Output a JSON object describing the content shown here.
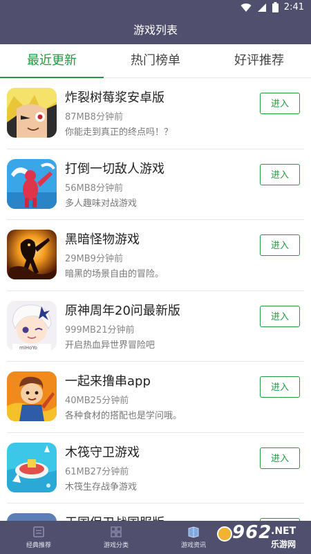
{
  "status_bar": {
    "time": "2:41"
  },
  "title_bar": {
    "title": "游戏列表"
  },
  "tabs": [
    {
      "label": "最近更新",
      "active": true
    },
    {
      "label": "热门榜单",
      "active": false
    },
    {
      "label": "好评推荐",
      "active": false
    }
  ],
  "apps": [
    {
      "name": "炸裂树莓浆安卓版",
      "meta": "87MB8分钟前",
      "desc": "你能走到真正的终点吗！？",
      "button": "进入",
      "icon": "anime-hero-icon"
    },
    {
      "name": "打倒一切敌人游戏",
      "meta": "56MB8分钟前",
      "desc": "多人趣味对战游戏",
      "button": "进入",
      "icon": "ragdoll-fighter-icon"
    },
    {
      "name": "黑暗怪物游戏",
      "meta": "29MB9分钟前",
      "desc": "暗黑的场景自由的冒险。",
      "button": "进入",
      "icon": "dark-monster-icon"
    },
    {
      "name": "原神周年20问最新版",
      "meta": "999MB21分钟前",
      "desc": "开启热血异世界冒险吧",
      "button": "进入",
      "icon": "genshin-paimon-icon"
    },
    {
      "name": "一起来撸串app",
      "meta": "40MB25分钟前",
      "desc": "各种食材的搭配也是学问哦。",
      "button": "进入",
      "icon": "cartoon-boy-icon"
    },
    {
      "name": "木筏守卫游戏",
      "meta": "61MB27分钟前",
      "desc": "木筏生存战争游戏",
      "button": "进入",
      "icon": "raft-icon"
    },
    {
      "name": "王国保卫战国服版",
      "meta": "",
      "desc": "",
      "button": "进入",
      "icon": "kingdom-icon"
    }
  ],
  "bottom_nav": [
    {
      "label": "经典推荐",
      "icon": "list-icon"
    },
    {
      "label": "游戏分类",
      "icon": "grid-icon"
    },
    {
      "label": "游戏资讯",
      "icon": "news-icon"
    }
  ],
  "watermark": {
    "number": "962",
    "domain": ".NET",
    "subtitle": "乐游网"
  },
  "colors": {
    "header_bg": "#514f6e",
    "accent": "#1f9a3c"
  }
}
